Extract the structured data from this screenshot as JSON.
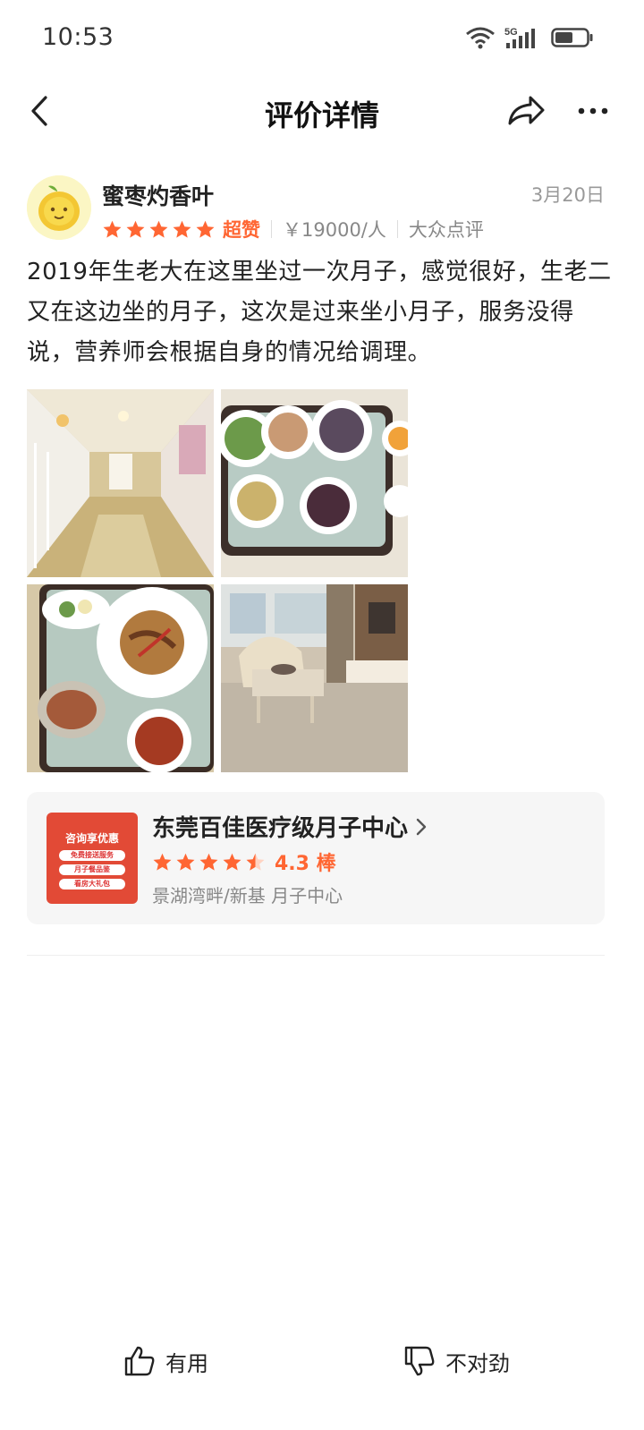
{
  "status_bar": {
    "time": "10:53",
    "network": "5G",
    "icons": [
      "wifi-icon",
      "signal-icon",
      "battery-icon"
    ]
  },
  "nav": {
    "title": "评价详情",
    "back_icon": "chevron-left-icon",
    "share_icon": "share-arrow-icon",
    "more_icon": "more-dots-icon"
  },
  "review": {
    "user_name": "蜜枣灼香叶",
    "date": "3月20日",
    "stars": 5,
    "rating_word": "超赞",
    "price": "￥19000/人",
    "source": "大众点评",
    "text": "2019年生老大在这里坐过一次月子，感觉很好，生老二又在这边坐的月子，这次是过来坐小月子，服务没得说，营养师会根据自身的情况给调理。",
    "photos": [
      "hallway-photo",
      "meal-tray-photo",
      "pasta-meal-photo",
      "living-room-photo"
    ]
  },
  "shop": {
    "name": "东莞百佳医疗级月子中心",
    "stars": 4.5,
    "score": "4.3 棒",
    "location": "景湖湾畔/新基 月子中心",
    "thumb": {
      "banner": "咨询享优惠",
      "items": [
        "免费接送服务",
        "月子餐品鉴",
        "看房大礼包"
      ]
    }
  },
  "actions": {
    "useful": "有用",
    "wrong": "不对劲"
  },
  "colors": {
    "accent": "#ff6633",
    "text": "#222222",
    "muted": "#999999",
    "card_bg": "#f6f6f6"
  }
}
